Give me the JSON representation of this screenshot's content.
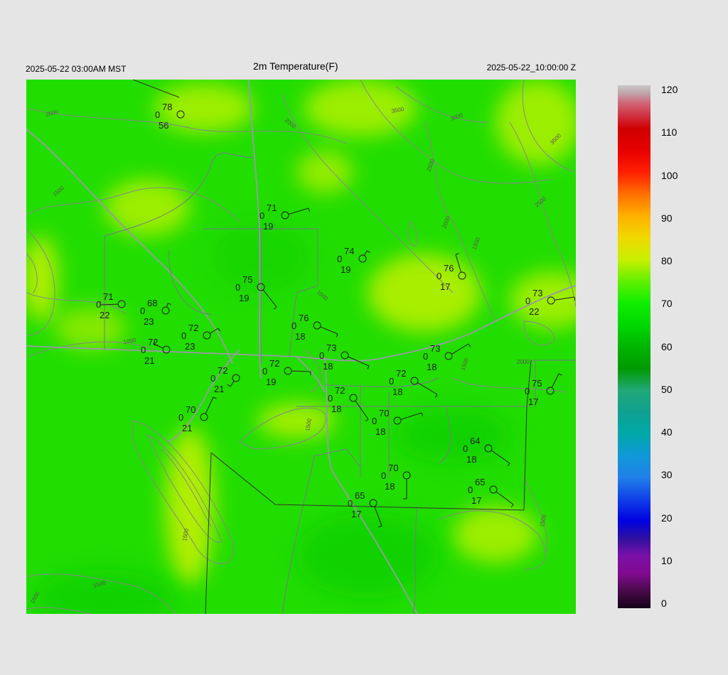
{
  "header": {
    "left": "2025-05-22 03:00AM MST",
    "title": "2m Temperature(F)",
    "right": "2025-05-22_10:00:00 Z"
  },
  "colorbar": {
    "labels": [
      "120",
      "110",
      "100",
      "90",
      "80",
      "70",
      "60",
      "50",
      "40",
      "30",
      "20",
      "10",
      "0"
    ]
  },
  "contour_labels": [
    "2000",
    "2000",
    "3500",
    "3000",
    "3500",
    "2500",
    "2500",
    "2000",
    "1500",
    "1500",
    "1500",
    "1000",
    "1500",
    "2000",
    "1500",
    "1500",
    "1500",
    "1500",
    "1500"
  ],
  "stations": [
    {
      "t": "78",
      "p": "0",
      "d": "56"
    },
    {
      "t": "71",
      "p": "0",
      "d": "19"
    },
    {
      "t": "74",
      "p": "0",
      "d": "19"
    },
    {
      "t": "76",
      "p": "0",
      "d": "17"
    },
    {
      "t": "75",
      "p": "0",
      "d": "19"
    },
    {
      "t": "71",
      "p": "0",
      "d": "22"
    },
    {
      "t": "68",
      "p": "0",
      "d": "23"
    },
    {
      "t": "73",
      "p": "0",
      "d": "22"
    },
    {
      "t": "76",
      "p": "0",
      "d": "18"
    },
    {
      "t": "72",
      "p": "0",
      "d": "23"
    },
    {
      "t": "72",
      "p": "0",
      "d": "21"
    },
    {
      "t": "73",
      "p": "0",
      "d": "18"
    },
    {
      "t": "73",
      "p": "0",
      "d": "18"
    },
    {
      "t": "72",
      "p": "0",
      "d": "19"
    },
    {
      "t": "72",
      "p": "0",
      "d": "21"
    },
    {
      "t": "72",
      "p": "0",
      "d": "18"
    },
    {
      "t": "75",
      "p": "0",
      "d": "17"
    },
    {
      "t": "72",
      "p": "0",
      "d": "18"
    },
    {
      "t": "70",
      "p": "0",
      "d": "21"
    },
    {
      "t": "70",
      "p": "0",
      "d": "18"
    },
    {
      "t": "64",
      "p": "0",
      "d": "18"
    },
    {
      "t": "70",
      "p": "0",
      "d": "18"
    },
    {
      "t": "65",
      "p": "0",
      "d": "17"
    },
    {
      "t": "65",
      "p": "0",
      "d": "17"
    }
  ]
}
